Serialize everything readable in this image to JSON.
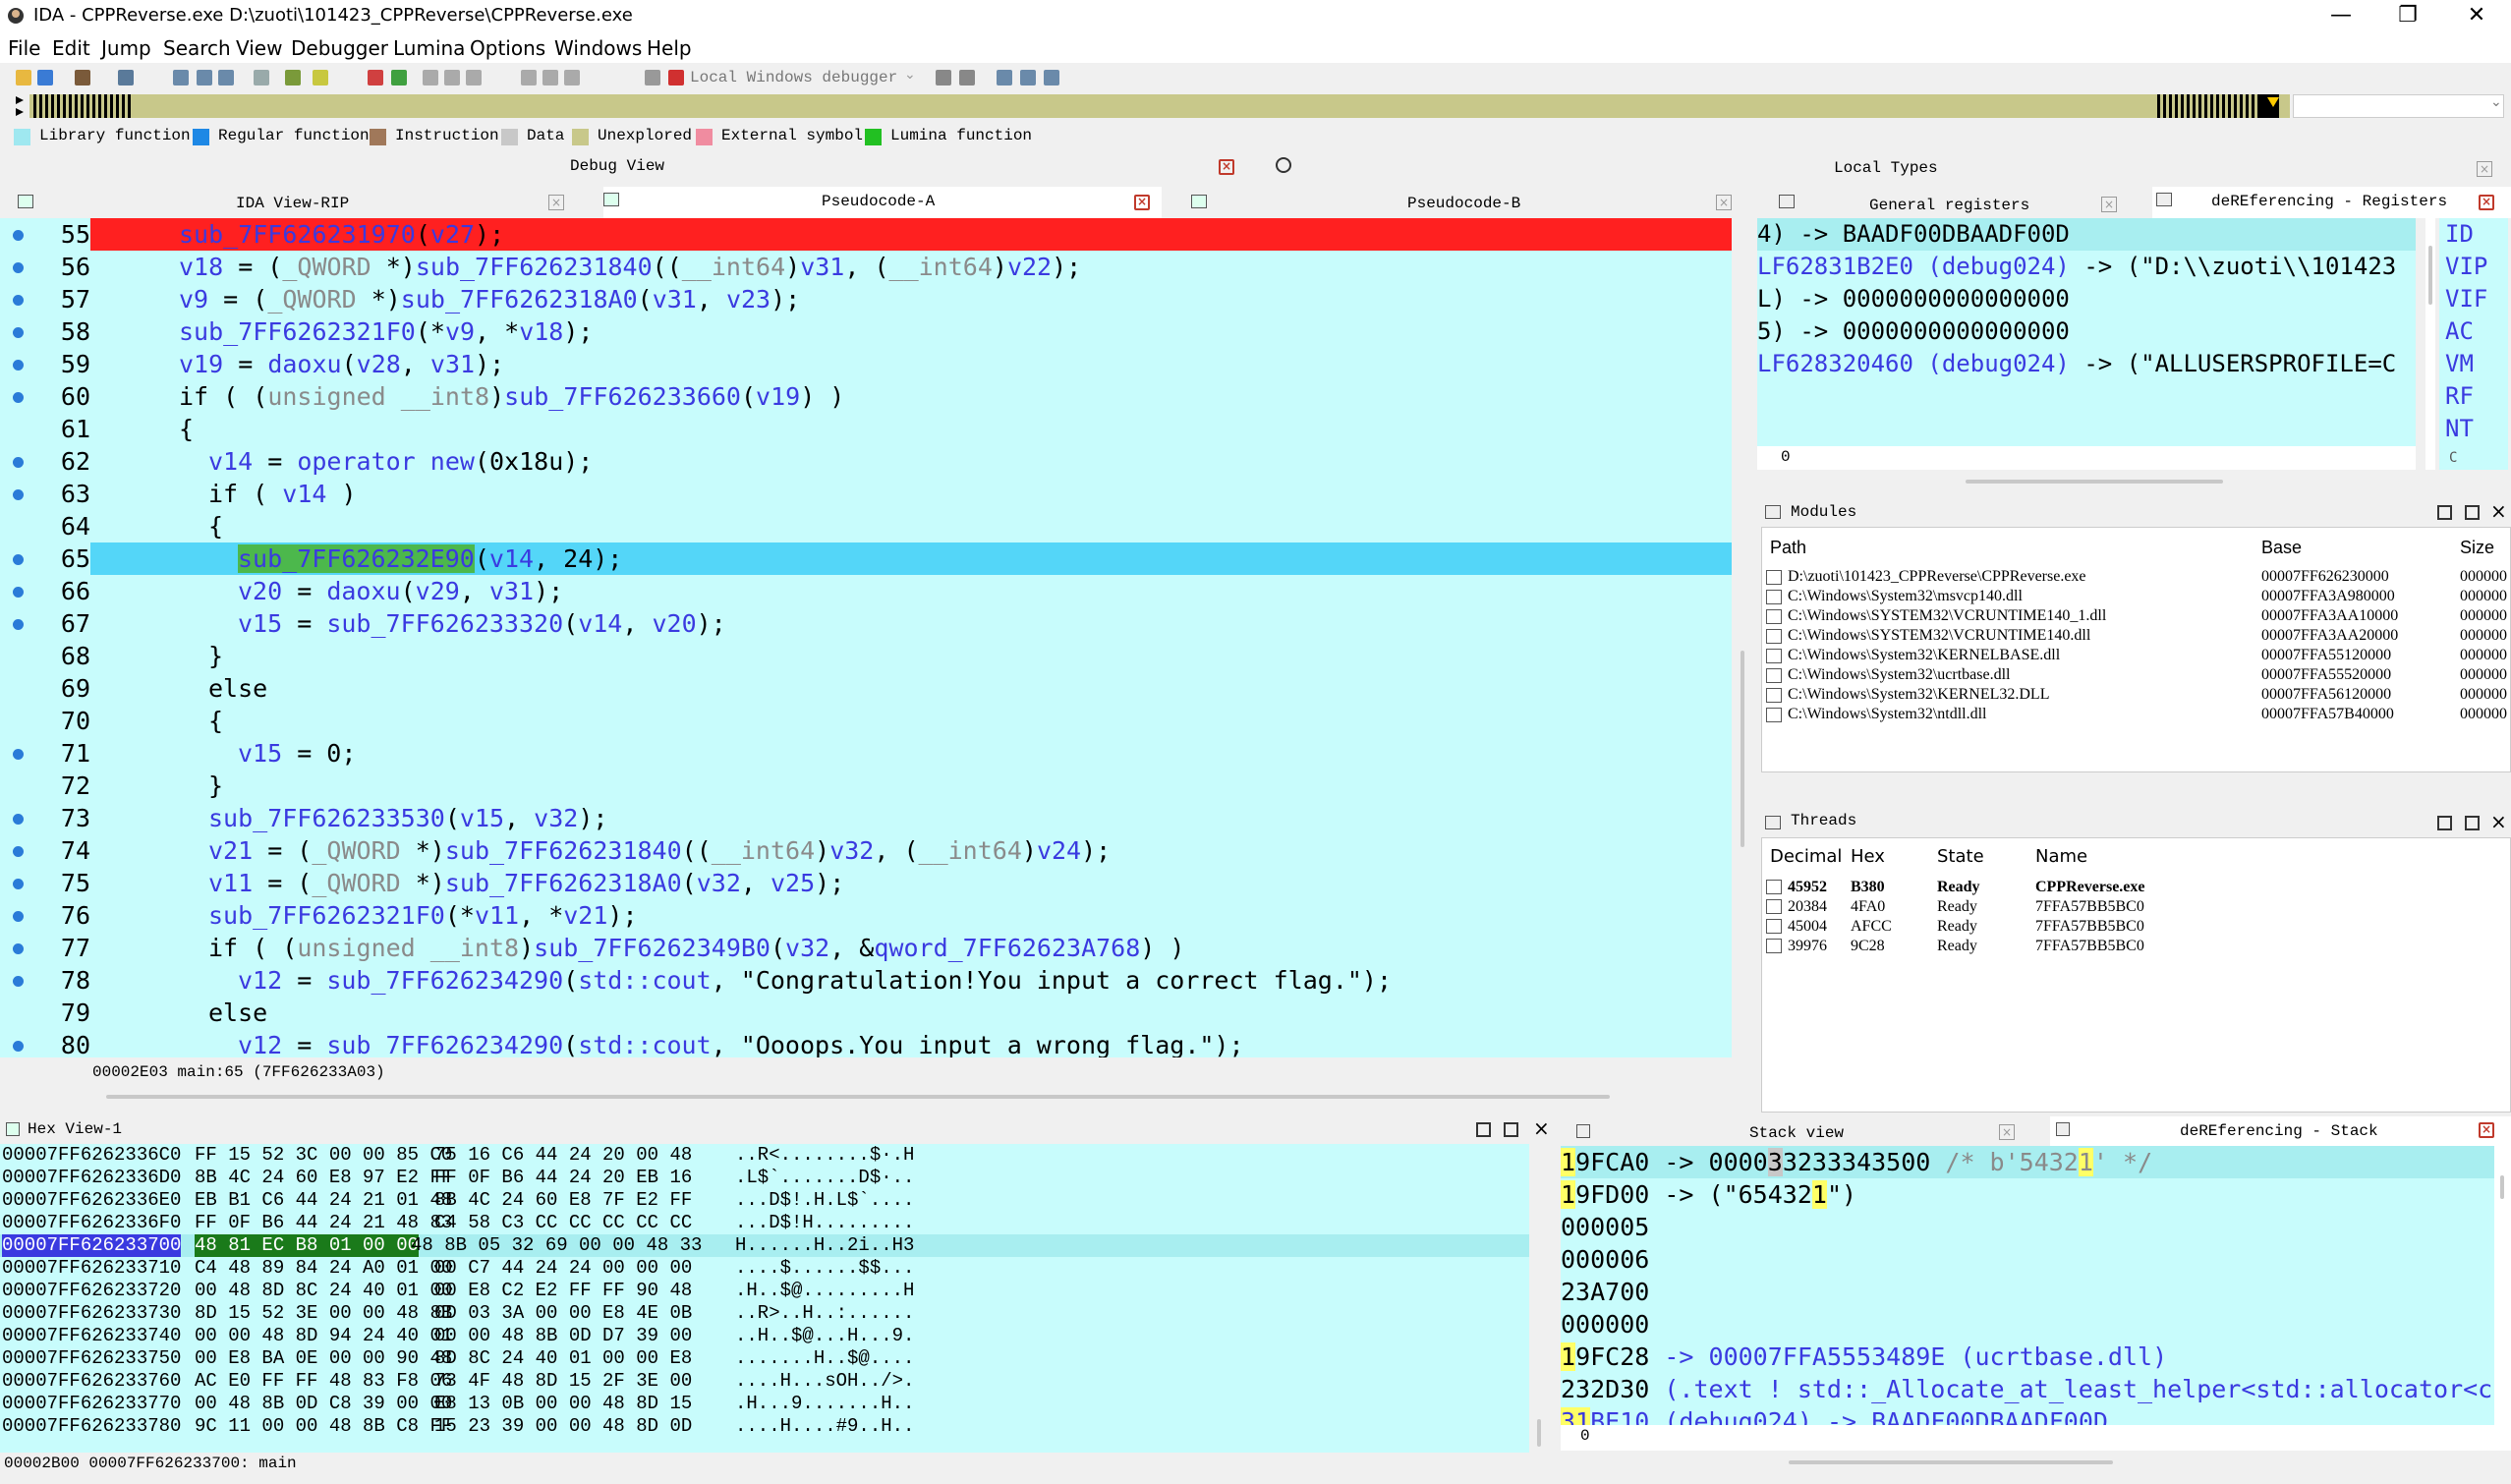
{
  "titlebar": {
    "title": "IDA - CPPReverse.exe D:\\zuoti\\101423_CPPReverse\\CPPReverse.exe",
    "minimize": "—",
    "maximize": "❐",
    "close": "✕"
  },
  "menu": [
    "File",
    "Edit",
    "Jump",
    "Search",
    "View",
    "Debugger",
    "Lumina",
    "Options",
    "Windows",
    "Help"
  ],
  "toolbar": {
    "debugger": "Local Windows debugger"
  },
  "legend": [
    {
      "label": "Library function",
      "color": "#9fe8f0"
    },
    {
      "label": "Regular function",
      "color": "#1e88e5"
    },
    {
      "label": "Instruction",
      "color": "#a0785a"
    },
    {
      "label": "Data",
      "color": "#c8c8c8"
    },
    {
      "label": "Unexplored",
      "color": "#c8c88a"
    },
    {
      "label": "External symbol",
      "color": "#f08ca0"
    },
    {
      "label": "Lumina function",
      "color": "#22c022"
    }
  ],
  "panels": {
    "debug_view": "Debug View",
    "local_types": "Local Types",
    "tab_ida": "IDA View-RIP",
    "tab_pa": "Pseudocode-A",
    "tab_pb": "Pseudocode-B",
    "tab_gr": "General registers",
    "tab_dr": "deREferencing - Registers",
    "modules": "Modules",
    "threads": "Threads",
    "hex": "Hex View-1",
    "stack": "Stack view",
    "dstack": "deREferencing - Stack"
  },
  "code": [
    {
      "n": "55",
      "dot": true,
      "parts": [
        [
          "sub_7FF626231970",
          "p"
        ],
        [
          "(",
          "k"
        ],
        [
          "v27",
          "p"
        ],
        [
          ");",
          "k"
        ]
      ],
      "indent": 2,
      "hl": "red"
    },
    {
      "n": "56",
      "dot": true,
      "parts": [
        [
          "v18",
          "p"
        ],
        [
          " = (",
          "k"
        ],
        [
          "_QWORD",
          "g"
        ],
        [
          " *)",
          "k"
        ],
        [
          "sub_7FF626231840",
          "p"
        ],
        [
          "((",
          "k"
        ],
        [
          "__int64",
          "g"
        ],
        [
          ")",
          "k"
        ],
        [
          "v31",
          "p"
        ],
        [
          ", (",
          "k"
        ],
        [
          "__int64",
          "g"
        ],
        [
          ")",
          "k"
        ],
        [
          "v22",
          "p"
        ],
        [
          ");",
          "k"
        ]
      ],
      "indent": 2
    },
    {
      "n": "57",
      "dot": true,
      "parts": [
        [
          "v9",
          "p"
        ],
        [
          " = (",
          "k"
        ],
        [
          "_QWORD",
          "g"
        ],
        [
          " *)",
          "k"
        ],
        [
          "sub_7FF6262318A0",
          "p"
        ],
        [
          "(",
          "k"
        ],
        [
          "v31",
          "p"
        ],
        [
          ", ",
          "k"
        ],
        [
          "v23",
          "p"
        ],
        [
          ");",
          "k"
        ]
      ],
      "indent": 2
    },
    {
      "n": "58",
      "dot": true,
      "parts": [
        [
          "sub_7FF6262321F0",
          "p"
        ],
        [
          "(*",
          "k"
        ],
        [
          "v9",
          "p"
        ],
        [
          ", *",
          "k"
        ],
        [
          "v18",
          "p"
        ],
        [
          ");",
          "k"
        ]
      ],
      "indent": 2
    },
    {
      "n": "59",
      "dot": true,
      "parts": [
        [
          "v19",
          "p"
        ],
        [
          " = ",
          "k"
        ],
        [
          "daoxu",
          "p"
        ],
        [
          "(",
          "k"
        ],
        [
          "v28",
          "p"
        ],
        [
          ", ",
          "k"
        ],
        [
          "v31",
          "p"
        ],
        [
          ");",
          "k"
        ]
      ],
      "indent": 2
    },
    {
      "n": "60",
      "dot": true,
      "parts": [
        [
          "if ( (",
          "k"
        ],
        [
          "unsigned __int8",
          "g"
        ],
        [
          ")",
          "k"
        ],
        [
          "sub_7FF626233660",
          "p"
        ],
        [
          "(",
          "k"
        ],
        [
          "v19",
          "p"
        ],
        [
          ") )",
          "k"
        ]
      ],
      "indent": 2
    },
    {
      "n": "61",
      "dot": false,
      "parts": [
        [
          "{",
          "k"
        ]
      ],
      "indent": 2
    },
    {
      "n": "62",
      "dot": true,
      "parts": [
        [
          "v14",
          "p"
        ],
        [
          " = ",
          "k"
        ],
        [
          "operator new",
          "p"
        ],
        [
          "(0x18u);",
          "k"
        ]
      ],
      "indent": 4
    },
    {
      "n": "63",
      "dot": true,
      "parts": [
        [
          "if ( ",
          "k"
        ],
        [
          "v14",
          "p"
        ],
        [
          " )",
          "k"
        ]
      ],
      "indent": 4
    },
    {
      "n": "64",
      "dot": false,
      "parts": [
        [
          "{",
          "k"
        ]
      ],
      "indent": 4
    },
    {
      "n": "65",
      "dot": true,
      "parts": [
        [
          "sub_7FF626232E90",
          "p"
        ],
        [
          "(",
          "k"
        ],
        [
          "v14",
          "p"
        ],
        [
          ", 24);",
          "k"
        ]
      ],
      "indent": 6,
      "hl": "cur"
    },
    {
      "n": "66",
      "dot": true,
      "parts": [
        [
          "v20",
          "p"
        ],
        [
          " = ",
          "k"
        ],
        [
          "daoxu",
          "p"
        ],
        [
          "(",
          "k"
        ],
        [
          "v29",
          "p"
        ],
        [
          ", ",
          "k"
        ],
        [
          "v31",
          "p"
        ],
        [
          ");",
          "k"
        ]
      ],
      "indent": 6
    },
    {
      "n": "67",
      "dot": true,
      "parts": [
        [
          "v15",
          "p"
        ],
        [
          " = ",
          "k"
        ],
        [
          "sub_7FF626233320",
          "p"
        ],
        [
          "(",
          "k"
        ],
        [
          "v14",
          "p"
        ],
        [
          ", ",
          "k"
        ],
        [
          "v20",
          "p"
        ],
        [
          ");",
          "k"
        ]
      ],
      "indent": 6
    },
    {
      "n": "68",
      "dot": false,
      "parts": [
        [
          "}",
          "k"
        ]
      ],
      "indent": 4
    },
    {
      "n": "69",
      "dot": false,
      "parts": [
        [
          "else",
          "k"
        ]
      ],
      "indent": 4
    },
    {
      "n": "70",
      "dot": false,
      "parts": [
        [
          "{",
          "k"
        ]
      ],
      "indent": 4
    },
    {
      "n": "71",
      "dot": true,
      "parts": [
        [
          "v15",
          "p"
        ],
        [
          " = 0;",
          "k"
        ]
      ],
      "indent": 6
    },
    {
      "n": "72",
      "dot": false,
      "parts": [
        [
          "}",
          "k"
        ]
      ],
      "indent": 4
    },
    {
      "n": "73",
      "dot": true,
      "parts": [
        [
          "sub_7FF626233530",
          "p"
        ],
        [
          "(",
          "k"
        ],
        [
          "v15",
          "p"
        ],
        [
          ", ",
          "k"
        ],
        [
          "v32",
          "p"
        ],
        [
          ");",
          "k"
        ]
      ],
      "indent": 4
    },
    {
      "n": "74",
      "dot": true,
      "parts": [
        [
          "v21",
          "p"
        ],
        [
          " = (",
          "k"
        ],
        [
          "_QWORD",
          "g"
        ],
        [
          " *)",
          "k"
        ],
        [
          "sub_7FF626231840",
          "p"
        ],
        [
          "((",
          "k"
        ],
        [
          "__int64",
          "g"
        ],
        [
          ")",
          "k"
        ],
        [
          "v32",
          "p"
        ],
        [
          ", (",
          "k"
        ],
        [
          "__int64",
          "g"
        ],
        [
          ")",
          "k"
        ],
        [
          "v24",
          "p"
        ],
        [
          ");",
          "k"
        ]
      ],
      "indent": 4
    },
    {
      "n": "75",
      "dot": true,
      "parts": [
        [
          "v11",
          "p"
        ],
        [
          " = (",
          "k"
        ],
        [
          "_QWORD",
          "g"
        ],
        [
          " *)",
          "k"
        ],
        [
          "sub_7FF6262318A0",
          "p"
        ],
        [
          "(",
          "k"
        ],
        [
          "v32",
          "p"
        ],
        [
          ", ",
          "k"
        ],
        [
          "v25",
          "p"
        ],
        [
          ");",
          "k"
        ]
      ],
      "indent": 4
    },
    {
      "n": "76",
      "dot": true,
      "parts": [
        [
          "sub_7FF6262321F0",
          "p"
        ],
        [
          "(*",
          "k"
        ],
        [
          "v11",
          "p"
        ],
        [
          ", *",
          "k"
        ],
        [
          "v21",
          "p"
        ],
        [
          ");",
          "k"
        ]
      ],
      "indent": 4
    },
    {
      "n": "77",
      "dot": true,
      "parts": [
        [
          "if ( (",
          "k"
        ],
        [
          "unsigned __int8",
          "g"
        ],
        [
          ")",
          "k"
        ],
        [
          "sub_7FF6262349B0",
          "p"
        ],
        [
          "(",
          "k"
        ],
        [
          "v32",
          "p"
        ],
        [
          ", &",
          "k"
        ],
        [
          "qword_7FF62623A768",
          "p"
        ],
        [
          ") )",
          "k"
        ]
      ],
      "indent": 4
    },
    {
      "n": "78",
      "dot": true,
      "parts": [
        [
          "v12",
          "p"
        ],
        [
          " = ",
          "k"
        ],
        [
          "sub_7FF626234290",
          "p"
        ],
        [
          "(",
          "k"
        ],
        [
          "std::cout",
          "p"
        ],
        [
          ", \"Congratulation!You input a correct flag.\");",
          "k"
        ]
      ],
      "indent": 6
    },
    {
      "n": "79",
      "dot": false,
      "parts": [
        [
          "else",
          "k"
        ]
      ],
      "indent": 4
    },
    {
      "n": "80",
      "dot": true,
      "parts": [
        [
          "v12",
          "p"
        ],
        [
          " = ",
          "k"
        ],
        [
          "sub_7FF626234290",
          "p"
        ],
        [
          "(",
          "k"
        ],
        [
          "std::cout",
          "p"
        ],
        [
          ", \"Oooops.You input a wrong flag.\");",
          "k"
        ]
      ],
      "indent": 6
    }
  ],
  "code_status": "00002E03 main:65 (7FF626233A03)",
  "registers": [
    {
      "a": "4) -> BAADF00DBAADF00D",
      "b": ""
    },
    {
      "a": "LF62831B2E0 ",
      "b": "(debug024) -> (\"D:\\\\zuoti\\\\101423"
    },
    {
      "a": "L) -> 0000000000000000",
      "b": ""
    },
    {
      "a": "5) -> 0000000000000000",
      "b": ""
    },
    {
      "a": "LF628320460 ",
      "b": "(debug024) -> (\"ALLUSERSPROFILE=C"
    }
  ],
  "reg_zero": "0",
  "reg_side": [
    "ID",
    "VIP",
    "VIF",
    "AC",
    "VM",
    "RF",
    "NT"
  ],
  "reg_side_c": "C",
  "modules": {
    "headers": [
      "Path",
      "Base",
      "Size"
    ],
    "rows": [
      [
        "D:\\zuoti\\101423_CPPReverse\\CPPReverse.exe",
        "00007FF626230000",
        "000000"
      ],
      [
        "C:\\Windows\\System32\\msvcp140.dll",
        "00007FFA3A980000",
        "000000"
      ],
      [
        "C:\\Windows\\SYSTEM32\\VCRUNTIME140_1.dll",
        "00007FFA3AA10000",
        "000000"
      ],
      [
        "C:\\Windows\\SYSTEM32\\VCRUNTIME140.dll",
        "00007FFA3AA20000",
        "000000"
      ],
      [
        "C:\\Windows\\System32\\KERNELBASE.dll",
        "00007FFA55120000",
        "000000"
      ],
      [
        "C:\\Windows\\System32\\ucrtbase.dll",
        "00007FFA55520000",
        "000000"
      ],
      [
        "C:\\Windows\\System32\\KERNEL32.DLL",
        "00007FFA56120000",
        "000000"
      ],
      [
        "C:\\Windows\\System32\\ntdll.dll",
        "00007FFA57B40000",
        "000000"
      ]
    ]
  },
  "threads": {
    "headers": [
      "Decimal",
      "Hex",
      "State",
      "Name"
    ],
    "rows": [
      [
        "45952",
        "B380",
        "Ready",
        "CPPReverse.exe"
      ],
      [
        "20384",
        "4FA0",
        "Ready",
        "7FFA57BB5BC0"
      ],
      [
        "45004",
        "AFCC",
        "Ready",
        "7FFA57BB5BC0"
      ],
      [
        "39976",
        "9C28",
        "Ready",
        "7FFA57BB5BC0"
      ]
    ]
  },
  "hex": [
    [
      "00007FF6262336C0",
      "FF 15 52 3C 00 00 85 C0",
      "75 16 C6 44 24 20 00 48",
      "..R<........$·.H"
    ],
    [
      "00007FF6262336D0",
      "8B 4C 24 60 E8 97 E2 FF",
      "FF 0F B6 44 24 20 EB 16",
      ".L$`.......D$·.."
    ],
    [
      "00007FF6262336E0",
      "EB B1 C6 44 24 21 01 48",
      "8B 4C 24 60 E8 7F E2 FF",
      "...D$!.H.L$`...."
    ],
    [
      "00007FF6262336F0",
      "FF 0F B6 44 24 21 48 83",
      "C4 58 C3 CC CC CC CC CC",
      "...D$!H........."
    ],
    [
      "00007FF626233700",
      "48 81 EC B8 01 00 00",
      "48 8B 05 32 69 00 00 48 33",
      "H......H..2i..H3"
    ],
    [
      "00007FF626233710",
      "C4 48 89 84 24 A0 01 00",
      "00 C7 44 24 24 00 00 00",
      "....$......$$..."
    ],
    [
      "00007FF626233720",
      "00 48 8D 8C 24 40 01 00",
      "00 E8 C2 E2 FF FF 90 48",
      ".H..$@.........H"
    ],
    [
      "00007FF626233730",
      "8D 15 52 3E 00 00 48 8B",
      "0D 03 3A 00 00 E8 4E 0B",
      "..R>..H..:......"
    ],
    [
      "00007FF626233740",
      "00 00 48 8D 94 24 40 01",
      "00 00 48 8B 0D D7 39 00",
      "..H..$@...H...9."
    ],
    [
      "00007FF626233750",
      "00 E8 BA 0E 00 00 90 48",
      "8D 8C 24 40 01 00 00 E8",
      ".......H..$@...."
    ],
    [
      "00007FF626233760",
      "AC E0 FF FF 48 83 F8 06",
      "73 4F 48 8D 15 2F 3E 00",
      "....H...sOH../>."
    ],
    [
      "00007FF626233770",
      "00 48 8B 0D C8 39 00 00",
      "E8 13 0B 00 00 48 8D 15",
      ".H...9.......H.."
    ],
    [
      "00007FF626233780",
      "9C 11 00 00 48 8B C8 FF",
      "15 23 39 00 00 48 8D 0D",
      "....H....#9..H.."
    ]
  ],
  "hex_status": "00002B00 00007FF626233700: main",
  "stack": [
    {
      "a": "19FCA0",
      "b": " -> 0000",
      "c": "3",
      "d": "3233343500 ",
      "e": "/* b'5432",
      "f": "1",
      "g": "' */"
    },
    {
      "a": "19FD00",
      "b": " -> (\"65432",
      "c": "1",
      "d": "\")",
      "e": "",
      "f": "",
      "g": ""
    },
    {
      "a": "000005",
      "b": "",
      "c": "",
      "d": "",
      "e": "",
      "f": "",
      "g": ""
    },
    {
      "a": "000006",
      "b": "",
      "c": "",
      "d": "",
      "e": "",
      "f": "",
      "g": ""
    },
    {
      "a": "23A700",
      "b": "",
      "c": "",
      "d": "",
      "e": "",
      "f": "",
      "g": ""
    },
    {
      "a": "000000",
      "b": "",
      "c": "",
      "d": "",
      "e": "",
      "f": "",
      "g": ""
    },
    {
      "a": "19FC28",
      "b": " -> 00007FFA5553489E ",
      "c": "",
      "d": "(ucrtbase.dll)",
      "e": "",
      "f": "",
      "g": ""
    },
    {
      "a": "232D30",
      "b": " (.text ! std::_Allocate_at_least_helper<std::allocator<c",
      "c": "",
      "d": "",
      "e": "",
      "f": "",
      "g": ""
    },
    {
      "a": "31BE10",
      "b": " (debug024) -> BAADF00DBAADF00D",
      "c": "",
      "d": "",
      "e": "",
      "f": "",
      "g": ""
    }
  ],
  "stack_zero": "0"
}
